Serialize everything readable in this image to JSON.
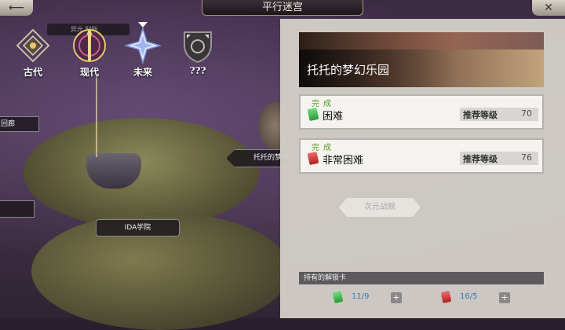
{
  "header": {
    "title": "平行迷宫",
    "back_icon": "back-arrow-icon",
    "close_icon": "close-icon",
    "back_glyph": "⟵",
    "close_glyph": "✕"
  },
  "eras": [
    {
      "label": "古代",
      "icon": "ancient-emblem-icon"
    },
    {
      "label": "现代",
      "icon": "modern-emblem-icon"
    },
    {
      "label": "未来",
      "icon": "future-emblem-icon"
    },
    {
      "label": "???",
      "icon": "unknown-emblem-icon"
    }
  ],
  "era_banner": "异元       制所",
  "map": {
    "label_huilang": "回廊",
    "label_ida": "IDA学院",
    "label_tuotuo": "托托的梦幻",
    "label_small": ""
  },
  "detail": {
    "title": "托托的梦幻乐园",
    "difficulties": [
      {
        "status": "完成",
        "name": "困难",
        "recommend_label": "推荐等级",
        "level": "70",
        "ticket_color": "#3aa84a"
      },
      {
        "status": "完成",
        "name": "非常困难",
        "recommend_label": "推荐等级",
        "level": "76",
        "ticket_color": "#c02a2a"
      }
    ],
    "dim_button": "次元战舰",
    "held_label": "持有的解锁卡",
    "held": [
      {
        "ticket_color": "#3aa84a",
        "count": "11/9"
      },
      {
        "ticket_color": "#c02a2a",
        "count": "16/5"
      }
    ]
  }
}
